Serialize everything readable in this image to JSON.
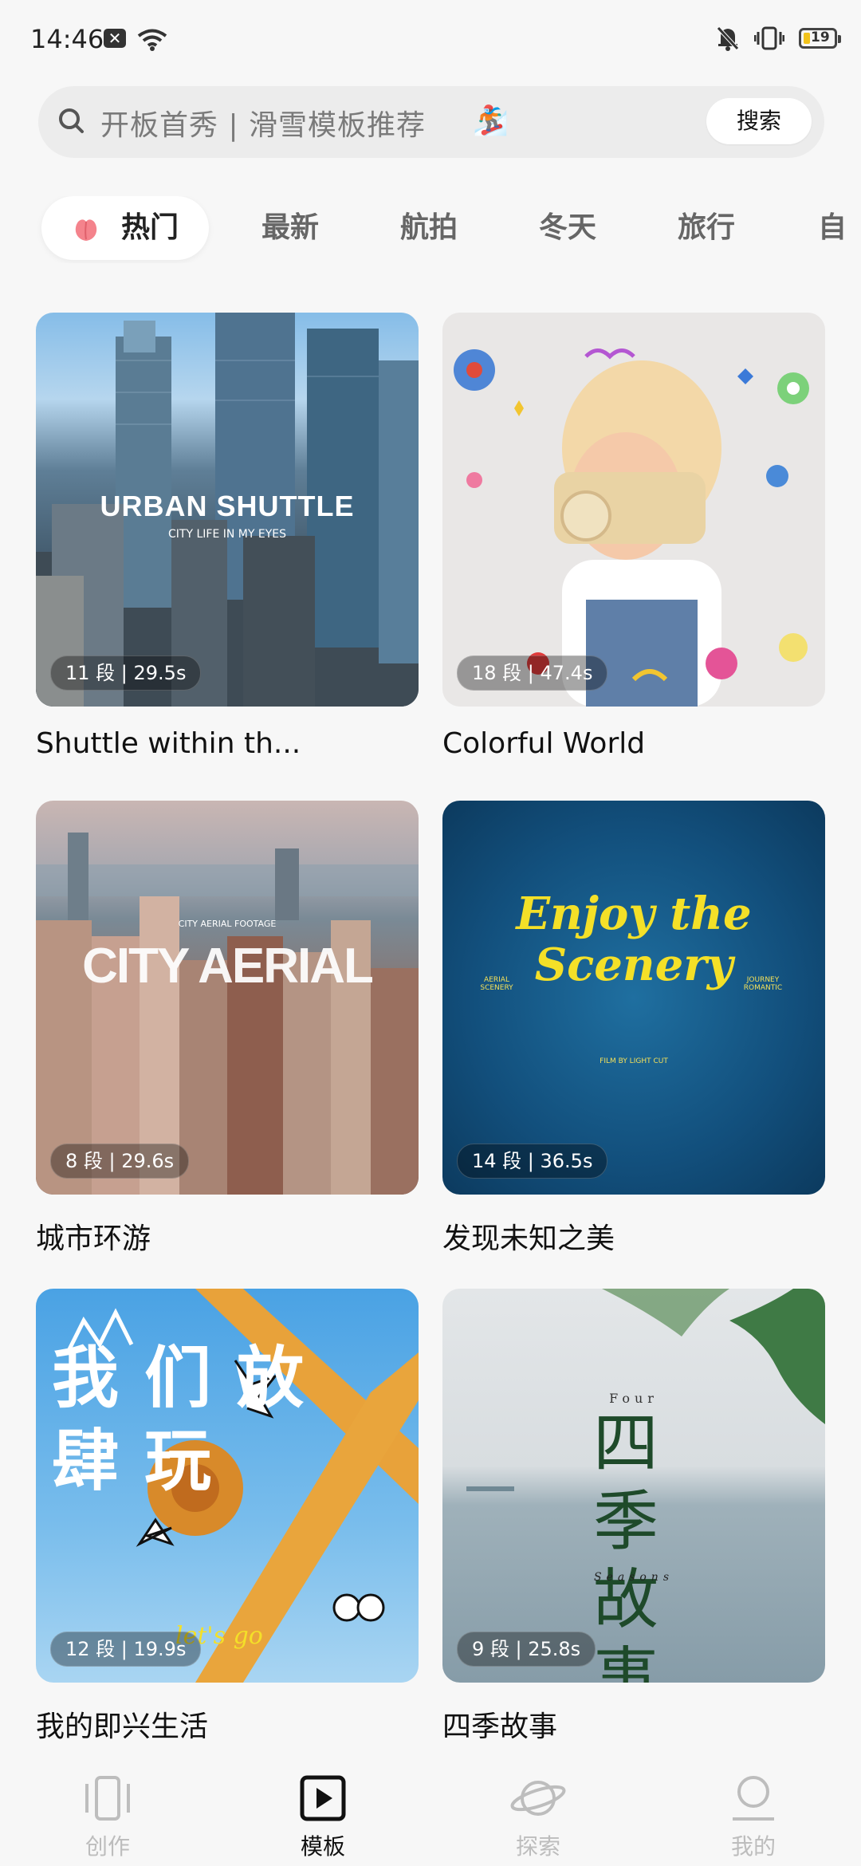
{
  "status_bar": {
    "time": "14:46",
    "battery": "19"
  },
  "search": {
    "placeholder": "开板首秀 | 滑雪模板推荐",
    "button_label": "搜索"
  },
  "tabs": [
    {
      "label": "热门",
      "active": true
    },
    {
      "label": "最新"
    },
    {
      "label": "航拍"
    },
    {
      "label": "冬天"
    },
    {
      "label": "旅行"
    },
    {
      "label": "自"
    }
  ],
  "templates": [
    {
      "title": "Shuttle within th...",
      "meta": "11 段 | 29.5s",
      "overlay": {
        "big": "URBAN SHUTTLE",
        "small": "CITY LIFE IN MY EYES"
      }
    },
    {
      "title": "Colorful World",
      "meta": "18 段 | 47.4s"
    },
    {
      "title": "城市环游",
      "meta": "8 段 | 29.6s",
      "overlay": {
        "big": "CITY AERIAL",
        "small": "CITY AERIAL FOOTAGE"
      }
    },
    {
      "title": "发现未知之美",
      "meta": "14 段 | 36.5s",
      "overlay": {
        "big": "Enjoy the Scenery",
        "left": "AERIAL SCENERY",
        "right": "JOURNEY ROMANTIC",
        "credit": "FILM BY LIGHT CUT"
      }
    },
    {
      "title": "我的即兴生活",
      "meta": "12 段 | 19.9s",
      "overlay": {
        "big": "我们放肆玩",
        "small": "let's go"
      }
    },
    {
      "title": "四季故事",
      "meta": "9 段 | 25.8s",
      "overlay": {
        "big": "四季故事",
        "top": "Four",
        "bottom": "Seasons"
      }
    }
  ],
  "bottom_nav": [
    {
      "label": "创作",
      "icon": "phone-frame-icon"
    },
    {
      "label": "模板",
      "icon": "play-square-icon",
      "active": true
    },
    {
      "label": "探索",
      "icon": "planet-icon"
    },
    {
      "label": "我的",
      "icon": "person-icon"
    }
  ]
}
